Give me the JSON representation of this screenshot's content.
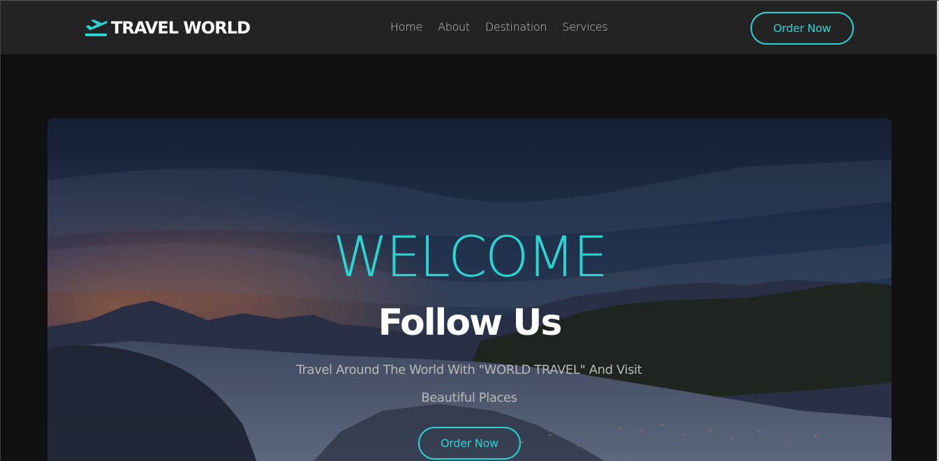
{
  "brand": {
    "logo_icon": "airplane-departure-icon",
    "name": "TRAVEL WORLD"
  },
  "nav": {
    "links": [
      {
        "label": "Home"
      },
      {
        "label": "About"
      },
      {
        "label": "Destination"
      },
      {
        "label": "Services"
      }
    ],
    "order_button_label": "Order Now"
  },
  "hero": {
    "welcome": "WELCOME",
    "headline": "Follow Us",
    "description": "Travel Around The World With \"WORLD TRAVEL\" And Visit Beautiful Places",
    "order_button_label": "Order Now",
    "background_image": "snowy-mountain-valley-at-sunset"
  },
  "colors": {
    "accent": "#2ad4d4",
    "navbar_bg": "#232323",
    "page_bg": "#101010",
    "text_light": "#ffffff",
    "text_muted": "#b9b9b9"
  }
}
